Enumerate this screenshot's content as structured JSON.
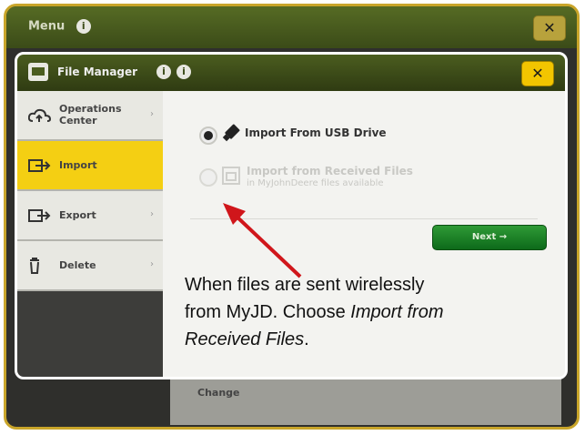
{
  "outer": {
    "title": "Menu",
    "info_glyph": "i",
    "close_label": "✕"
  },
  "background_card": {
    "label": "Change"
  },
  "dialog": {
    "title": "File Manager",
    "info_glyph_1": "i",
    "info_glyph_2": "i",
    "close_label": "✕"
  },
  "sidebar": {
    "items": [
      {
        "label": "Operations Center",
        "icon": "cloud-icon",
        "active": false
      },
      {
        "label": "Import",
        "icon": "import-icon",
        "active": true
      },
      {
        "label": "Export",
        "icon": "export-icon",
        "active": false
      },
      {
        "label": "Delete",
        "icon": "trash-icon",
        "active": false
      }
    ],
    "chevron": "›"
  },
  "options": {
    "usb": {
      "label": "Import From USB Drive",
      "selected": true,
      "icon": "usb-drive-icon"
    },
    "received": {
      "label": "Import from Received Files",
      "sublabel": "in MyJohnDeere files available",
      "selected": false,
      "enabled": false,
      "icon": "received-files-icon"
    }
  },
  "next_button": {
    "label": "Next →"
  },
  "annotation": {
    "line_1": "When files are sent wirelessly",
    "line_2_prefix": "from MyJD. Choose ",
    "line_2_italic": "Import from",
    "line_3_italic": "Received Files",
    "line_3_suffix": ".",
    "color": "#d0161b"
  },
  "colors": {
    "brand_green": "#3b4b18",
    "accent_yellow": "#f4cf13",
    "frame_gold": "#c9a52a",
    "next_green": "#1f8a2a"
  }
}
